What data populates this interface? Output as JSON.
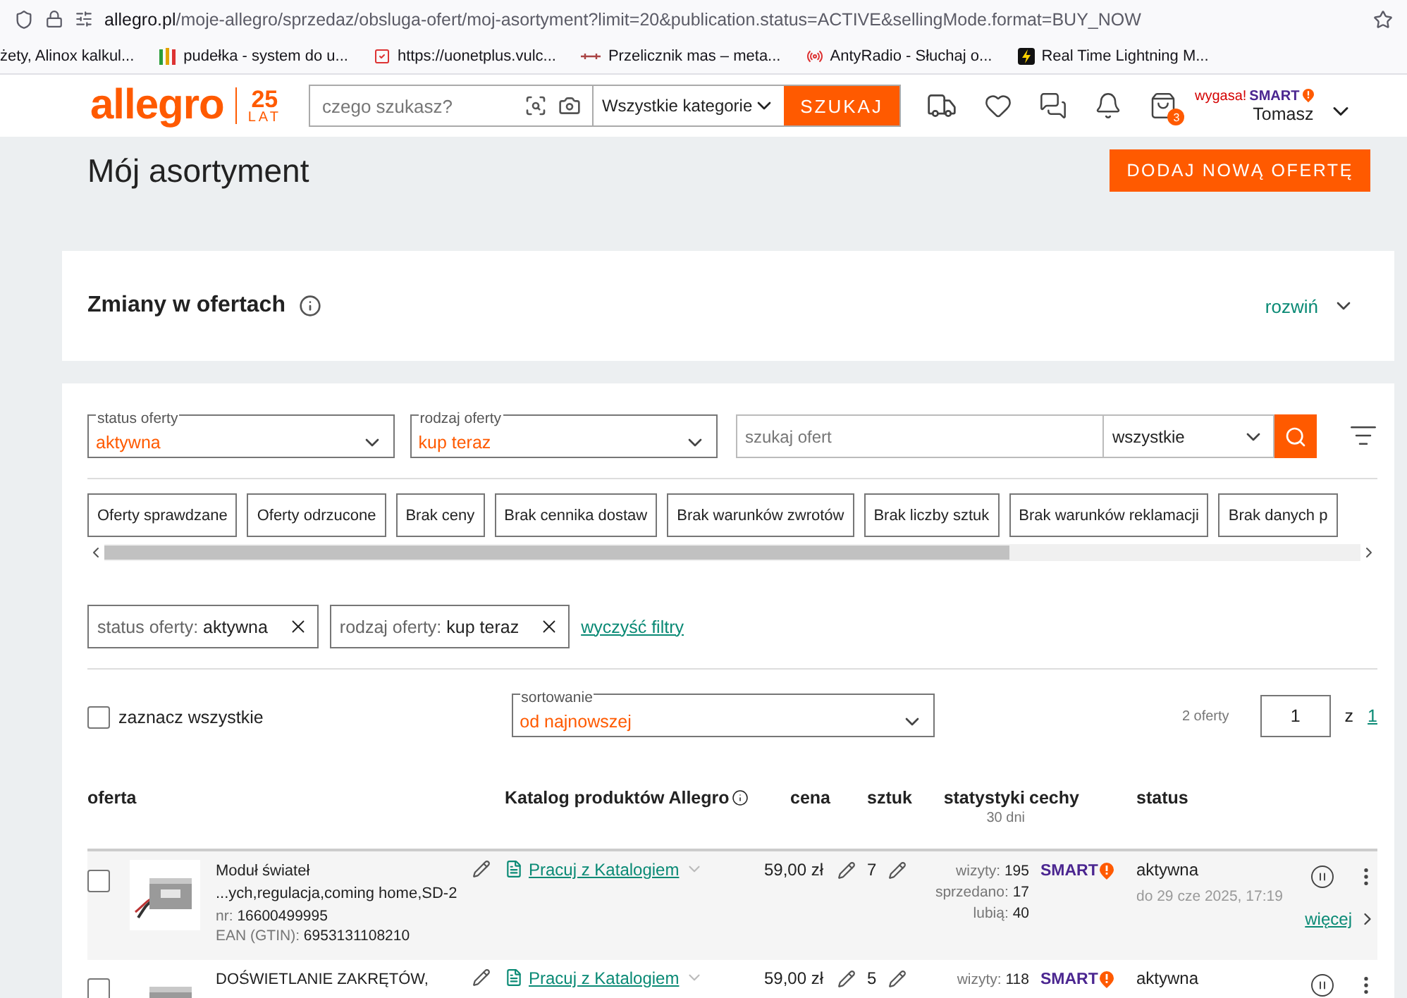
{
  "browser": {
    "url_host": "allegro.pl",
    "url_path": "/moje-allegro/sprzedaz/obsluga-ofert/moj-asortyment?limit=20&publication.status=ACTIVE&sellingMode.format=BUY_NOW"
  },
  "bookmarks": [
    {
      "kind": "none",
      "label": "żety, Alinox kalkul..."
    },
    {
      "kind": "bars",
      "label": "pudełka - system do u..."
    },
    {
      "kind": "check",
      "label": "https://uonetplus.vulc..."
    },
    {
      "kind": "scale",
      "label": "Przelicznik mas – meta..."
    },
    {
      "kind": "radio",
      "label": "AntyRadio - Słuchaj o..."
    },
    {
      "kind": "bolt",
      "label": "Real Time Lightning M..."
    }
  ],
  "header": {
    "logo": "allegro",
    "logo_number": "25",
    "logo_word": "LAT",
    "search_placeholder": "czego szukasz?",
    "category": "Wszystkie kategorie",
    "search_button": "SZUKAJ",
    "cart_count": "3",
    "smart_notice": "wygasa!",
    "smart_label": "SMART",
    "user": "Tomasz"
  },
  "page": {
    "title": "Mój asortyment",
    "add_button": "DODAJ NOWĄ OFERTĘ"
  },
  "changes": {
    "title": "Zmiany w ofertach",
    "expand": "rozwiń"
  },
  "filters": {
    "selects": [
      {
        "label": "status oferty",
        "value": "aktywna"
      },
      {
        "label": "rodzaj oferty",
        "value": "kup teraz"
      }
    ],
    "search_placeholder": "szukaj ofert",
    "scope": "wszystkie"
  },
  "quick_filters": [
    "Oferty sprawdzane",
    "Oferty odrzucone",
    "Brak ceny",
    "Brak cennika dostaw",
    "Brak warunków zwrotów",
    "Brak liczby sztuk",
    "Brak warunków reklamacji",
    "Brak danych p"
  ],
  "active_filters": [
    {
      "label": "status oferty:",
      "value": "aktywna"
    },
    {
      "label": "rodzaj oferty:",
      "value": "kup teraz"
    }
  ],
  "clear_filters": "wyczyść filtry",
  "select_all": {
    "label": "zaznacz wszystkie",
    "checked": false
  },
  "sort": {
    "label": "sortowanie",
    "value": "od najnowszej"
  },
  "pagination": {
    "count": "2 oferty",
    "page": "1",
    "of": "z",
    "total": "1"
  },
  "table": {
    "columns": [
      "oferta",
      "Katalog produktów Allegro",
      "cena",
      "sztuk",
      "statystyki",
      "cechy",
      "status"
    ],
    "stats_period": "30 dni",
    "rows": [
      {
        "checked": false,
        "title_lines": [
          "Moduł świateł",
          "...ych,regulacja,coming home,SD-2"
        ],
        "nr_label": "nr:",
        "nr": "16600499995",
        "ean_label": "EAN (GTIN):",
        "ean": "6953131108210",
        "catalog": "Pracuj z Katalogiem",
        "price": "59,00 zł",
        "qty": "7",
        "stats": [
          {
            "label": "wizyty:",
            "value": "195"
          },
          {
            "label": "sprzedano:",
            "value": "17"
          },
          {
            "label": "lubią:",
            "value": "40"
          }
        ],
        "feature": "SMART",
        "status": "aktywna",
        "until": "do 29 cze 2025, 17:19",
        "more": "więcej"
      },
      {
        "checked": false,
        "title_lines": [
          "DOŚWIETLANIE ZAKRĘTÓW,"
        ],
        "catalog": "Pracuj z Katalogiem",
        "price": "59,00 zł",
        "qty": "5",
        "stats": [
          {
            "label": "wizyty:",
            "value": "118"
          }
        ],
        "feature": "SMART",
        "status": "aktywna"
      }
    ]
  }
}
